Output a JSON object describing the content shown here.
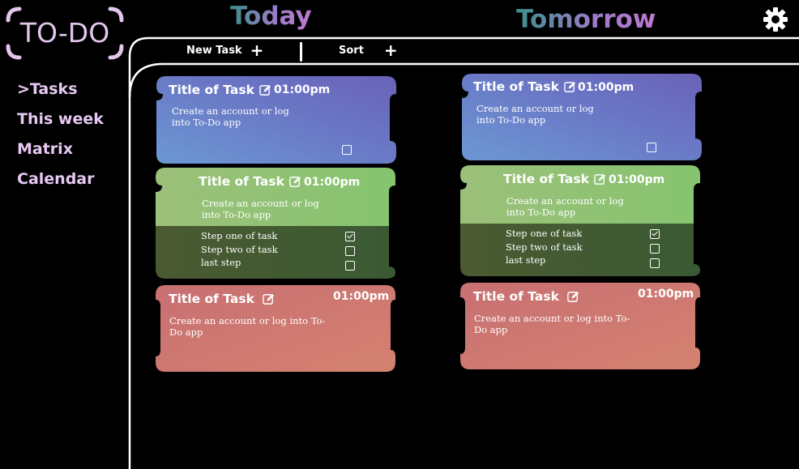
{
  "logo": {
    "text": "TO-DO"
  },
  "sidebar": {
    "items": [
      {
        "label": ">Tasks"
      },
      {
        "label": "This week"
      },
      {
        "label": "Matrix"
      },
      {
        "label": "Calendar"
      }
    ]
  },
  "columns": {
    "today": {
      "title": "Today"
    },
    "tomorrow": {
      "title": "Tomorrow"
    }
  },
  "toolbar": {
    "new_task_label": "New Task",
    "sort_label": "Sort",
    "plus": "+"
  },
  "cards": {
    "today_blue": {
      "title": "Title of Task",
      "time": "01:00pm",
      "desc_l1": "Create an account or log",
      "desc_l2": "into To-Do app",
      "checked": false
    },
    "today_green": {
      "title": "Title of Task",
      "time": "01:00pm",
      "desc_l1": "Create an account or log",
      "desc_l2": "into To-Do app",
      "steps": [
        {
          "label": "Step one of task",
          "checked": true
        },
        {
          "label": "Step two of task",
          "checked": false
        },
        {
          "label": "last step",
          "checked": false
        }
      ]
    },
    "today_red": {
      "title": "Title of Task",
      "time": "01:00pm",
      "desc_l1": "Create an account or log into To-",
      "desc_l2": "Do app"
    },
    "tomorrow_blue": {
      "title": "Title of Task",
      "time": "01:00pm",
      "desc_l1": "Create an account or log",
      "desc_l2": "into To-Do app",
      "checked": false
    },
    "tomorrow_green": {
      "title": "Title of Task",
      "time": "01:00pm",
      "desc_l1": "Create an account or log",
      "desc_l2": "into To-Do app",
      "steps": [
        {
          "label": "Step one of task",
          "checked": true
        },
        {
          "label": "Step two of task",
          "checked": false
        },
        {
          "label": "last step",
          "checked": false
        }
      ]
    },
    "tomorrow_red": {
      "title": "Title of Task",
      "time": "01:00pm",
      "desc_l1": "Create an account or log into To-",
      "desc_l2": "Do app"
    }
  },
  "colors": {
    "background": "#000000",
    "logo_text": "#e3c6ec",
    "nav_text": "#e6c8f2",
    "blue_card": "#6a74c4",
    "green_card": "#8bc26f",
    "green_card_steps": "#3e5a33",
    "red_card": "#d0786f"
  },
  "icons": {
    "settings": "gear-icon",
    "edit": "edit-icon",
    "plus": "plus-icon"
  }
}
